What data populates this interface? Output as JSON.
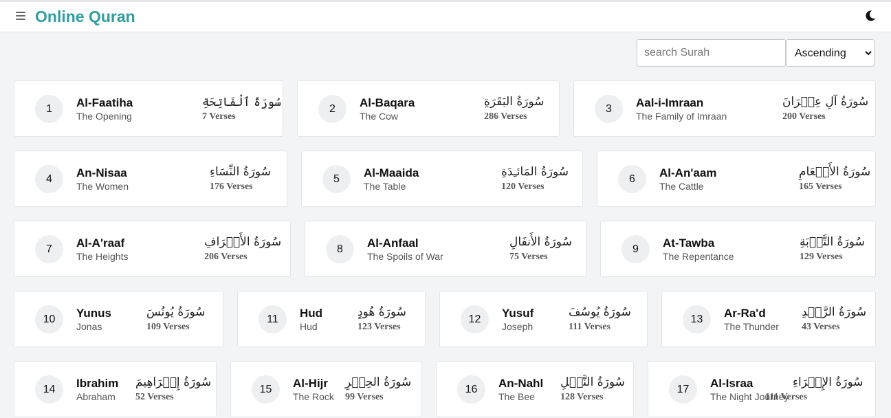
{
  "header": {
    "title": "Online Quran",
    "menu_icon": "hamburger-menu-icon",
    "theme_icon": "moon-icon"
  },
  "search": {
    "placeholder": "search Surah",
    "value": ""
  },
  "sort": {
    "selected": "Ascending",
    "options": [
      "Ascending"
    ]
  },
  "verses_suffix": "Verses",
  "surahs": [
    {
      "number": "1",
      "name": "Al-Faatiha",
      "translation": "The Opening",
      "arabic": "سُورَةُ ٱلْفَاتِحَةِ",
      "verses": "7 Verses"
    },
    {
      "number": "2",
      "name": "Al-Baqara",
      "translation": "The Cow",
      "arabic": "سُورَةُ البَقَرَةِ",
      "verses": "286 Verses"
    },
    {
      "number": "3",
      "name": "Aal-i-Imraan",
      "translation": "The Family of Imraan",
      "arabic": "سُورَةُ آلِ عِمۡرَانَ",
      "verses": "200 Verses"
    },
    {
      "number": "4",
      "name": "An-Nisaa",
      "translation": "The Women",
      "arabic": "سُورَةُ النِّسَاءِ",
      "verses": "176 Verses"
    },
    {
      "number": "5",
      "name": "Al-Maaida",
      "translation": "The Table",
      "arabic": "سُورَةُ المَائـِدَةِ",
      "verses": "120 Verses"
    },
    {
      "number": "6",
      "name": "Al-An'aam",
      "translation": "The Cattle",
      "arabic": "سُورَةُ الأَنۡعَامِ",
      "verses": "165 Verses"
    },
    {
      "number": "7",
      "name": "Al-A'raaf",
      "translation": "The Heights",
      "arabic": "سُورَةُ الأَعۡرَافِ",
      "verses": "206 Verses"
    },
    {
      "number": "8",
      "name": "Al-Anfaal",
      "translation": "The Spoils of War",
      "arabic": "سُورَةُ الأَنفَالِ",
      "verses": "75 Verses"
    },
    {
      "number": "9",
      "name": "At-Tawba",
      "translation": "The Repentance",
      "arabic": "سُورَةُ التَّوۡبَةِ",
      "verses": "129 Verses"
    },
    {
      "number": "10",
      "name": "Yunus",
      "translation": "Jonas",
      "arabic": "سُورَةُ يُونُسَ",
      "verses": "109 Verses"
    },
    {
      "number": "11",
      "name": "Hud",
      "translation": "Hud",
      "arabic": "سُورَةُ هُودٍ",
      "verses": "123 Verses"
    },
    {
      "number": "12",
      "name": "Yusuf",
      "translation": "Joseph",
      "arabic": "سُورَةُ يُوسُفَ",
      "verses": "111 Verses"
    },
    {
      "number": "13",
      "name": "Ar-Ra'd",
      "translation": "The Thunder",
      "arabic": "سُورَةُ الرَّعۡدِ",
      "verses": "43 Verses"
    },
    {
      "number": "14",
      "name": "Ibrahim",
      "translation": "Abraham",
      "arabic": "سُورَةُ إِبۡرَاهِيمَ",
      "verses": "52 Verses"
    },
    {
      "number": "15",
      "name": "Al-Hijr",
      "translation": "The Rock",
      "arabic": "سُورَةُ الحِجۡرِ",
      "verses": "99 Verses"
    },
    {
      "number": "16",
      "name": "An-Nahl",
      "translation": "The Bee",
      "arabic": "سُورَةُ النَّحۡلِ",
      "verses": "128 Verses"
    },
    {
      "number": "17",
      "name": "Al-Israa",
      "translation": "The Night Journey",
      "arabic": "سُورَةُ الإِسۡرَاءِ",
      "verses": "111 Verses"
    }
  ]
}
